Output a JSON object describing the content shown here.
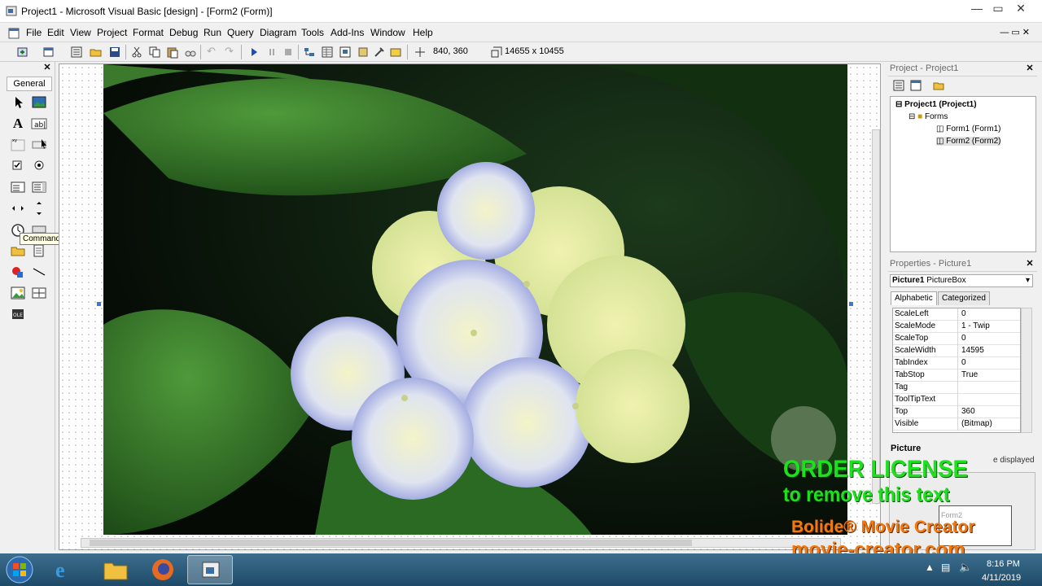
{
  "window": {
    "title": "Project1 - Microsoft Visual Basic [design] - [Form2 (Form)]",
    "buttons": [
      "minimize",
      "maximize",
      "close"
    ]
  },
  "menu": [
    "File",
    "Edit",
    "View",
    "Project",
    "Format",
    "Debug",
    "Run",
    "Query",
    "Diagram",
    "Tools",
    "Add-Ins",
    "Window",
    "Help"
  ],
  "toolbar": {
    "position": "840, 360",
    "size": "14655 x 10455"
  },
  "toolbox": {
    "tab": "General",
    "tooltip": "CommandButton",
    "tools": [
      "pointer-icon",
      "picturebox-icon",
      "label-icon",
      "textbox-icon",
      "frame-icon",
      "commandbutton-icon",
      "checkbox-icon",
      "optionbutton-icon",
      "combobox-icon",
      "listbox-icon",
      "hscrollbar-icon",
      "vscrollbar-icon",
      "timer-icon",
      "drivelistbox-icon",
      "dirlistbox-icon",
      "filelistbox-icon",
      "shape-icon",
      "line-icon",
      "image-icon",
      "data-icon",
      "ole-icon"
    ]
  },
  "project": {
    "title": "Project - Project1",
    "root": "Project1 (Project1)",
    "folder": "Forms",
    "items": [
      "Form1 (Form1)",
      "Form2 (Form2)"
    ]
  },
  "properties": {
    "title": "Properties - Picture1",
    "object": "Picture1",
    "object_type": "PictureBox",
    "tabs": [
      "Alphabetic",
      "Categorized"
    ],
    "rows": [
      {
        "name": "ScaleLeft",
        "value": "0"
      },
      {
        "name": "ScaleMode",
        "value": "1 - Twip"
      },
      {
        "name": "ScaleTop",
        "value": "0"
      },
      {
        "name": "ScaleWidth",
        "value": "14595"
      },
      {
        "name": "TabIndex",
        "value": "0"
      },
      {
        "name": "TabStop",
        "value": "True"
      },
      {
        "name": "Tag",
        "value": ""
      },
      {
        "name": "ToolTipText",
        "value": ""
      },
      {
        "name": "Top",
        "value": "360"
      },
      {
        "name": "Visible",
        "value": "(Bitmap)"
      }
    ],
    "desc_title": "Picture",
    "desc_text": "e displayed"
  },
  "layout_window": {
    "label": "Form2"
  },
  "watermark": {
    "line1": "ORDER LICENSE",
    "line2": "to remove this text",
    "line3": "Bolide® Movie Creator",
    "line4": "movie-creator.com"
  },
  "taskbar": {
    "time": "8:16 PM",
    "date": "4/11/2019"
  },
  "colors": {
    "watermark_green": "#1ee01e",
    "watermark_orange": "#f07a10",
    "taskbar": "#2d5b7a"
  }
}
